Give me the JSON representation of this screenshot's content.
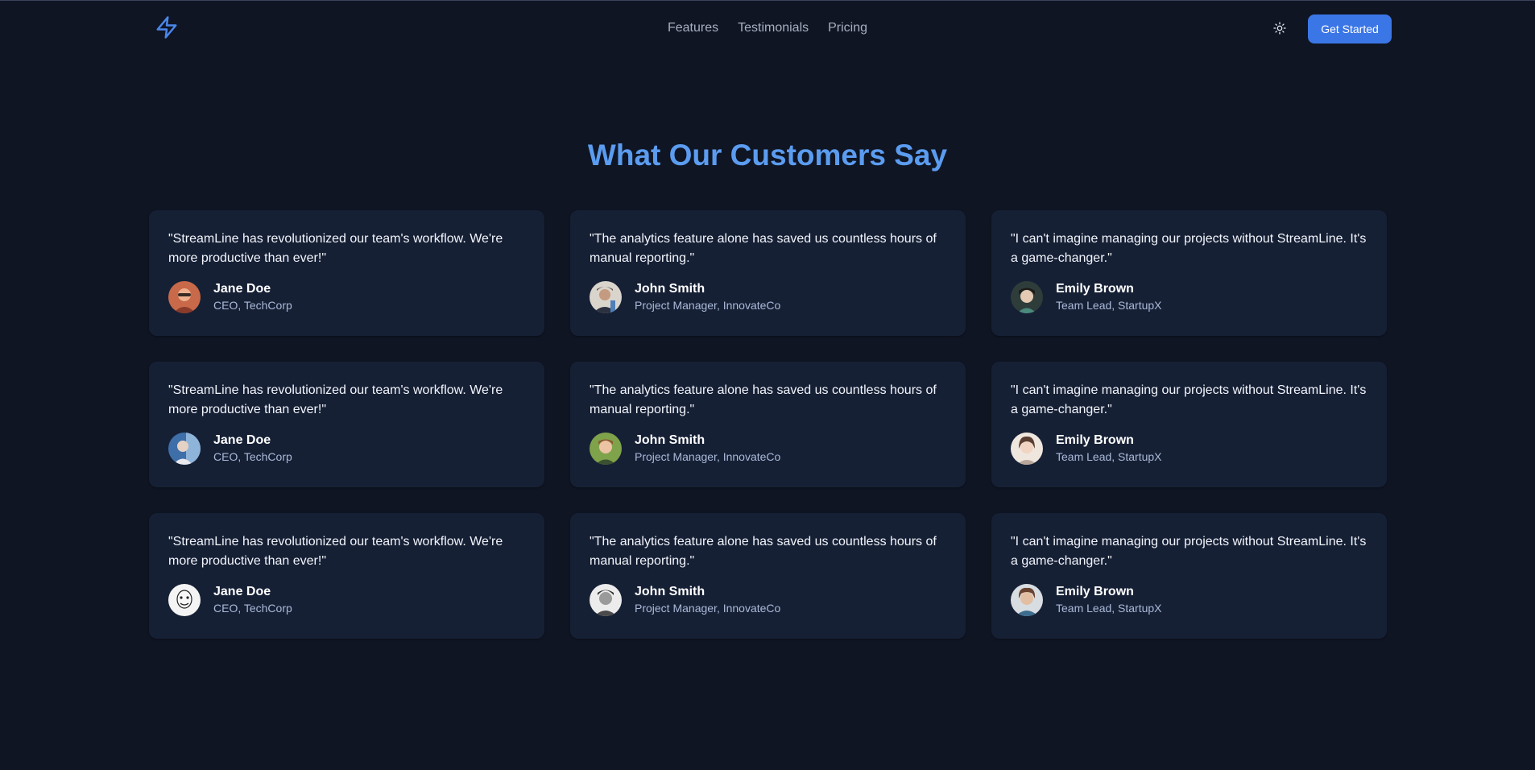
{
  "header": {
    "logo_icon": "lightning-bolt-icon",
    "nav": [
      {
        "label": "Features"
      },
      {
        "label": "Testimonials"
      },
      {
        "label": "Pricing"
      }
    ],
    "theme_icon": "sun-icon",
    "cta_label": "Get Started"
  },
  "testimonials": {
    "title": "What Our Customers Say",
    "cards": [
      {
        "quote": "\"StreamLine has revolutionized our team's workflow. We're more productive than ever!\"",
        "name": "Jane Doe",
        "role": "CEO, TechCorp"
      },
      {
        "quote": "\"The analytics feature alone has saved us countless hours of manual reporting.\"",
        "name": "John Smith",
        "role": "Project Manager, InnovateCo"
      },
      {
        "quote": "\"I can't imagine managing our projects without StreamLine. It's a game-changer.\"",
        "name": "Emily Brown",
        "role": "Team Lead, StartupX"
      },
      {
        "quote": "\"StreamLine has revolutionized our team's workflow. We're more productive than ever!\"",
        "name": "Jane Doe",
        "role": "CEO, TechCorp"
      },
      {
        "quote": "\"The analytics feature alone has saved us countless hours of manual reporting.\"",
        "name": "John Smith",
        "role": "Project Manager, InnovateCo"
      },
      {
        "quote": "\"I can't imagine managing our projects without StreamLine. It's a game-changer.\"",
        "name": "Emily Brown",
        "role": "Team Lead, StartupX"
      },
      {
        "quote": "\"StreamLine has revolutionized our team's workflow. We're more productive than ever!\"",
        "name": "Jane Doe",
        "role": "CEO, TechCorp"
      },
      {
        "quote": "\"The analytics feature alone has saved us countless hours of manual reporting.\"",
        "name": "John Smith",
        "role": "Project Manager, InnovateCo"
      },
      {
        "quote": "\"I can't imagine managing our projects without StreamLine. It's a game-changer.\"",
        "name": "Emily Brown",
        "role": "Team Lead, StartupX"
      }
    ]
  },
  "colors": {
    "background": "#0f1523",
    "card": "#162035",
    "accent": "#3b76e6",
    "title": "#5b9cf0"
  }
}
